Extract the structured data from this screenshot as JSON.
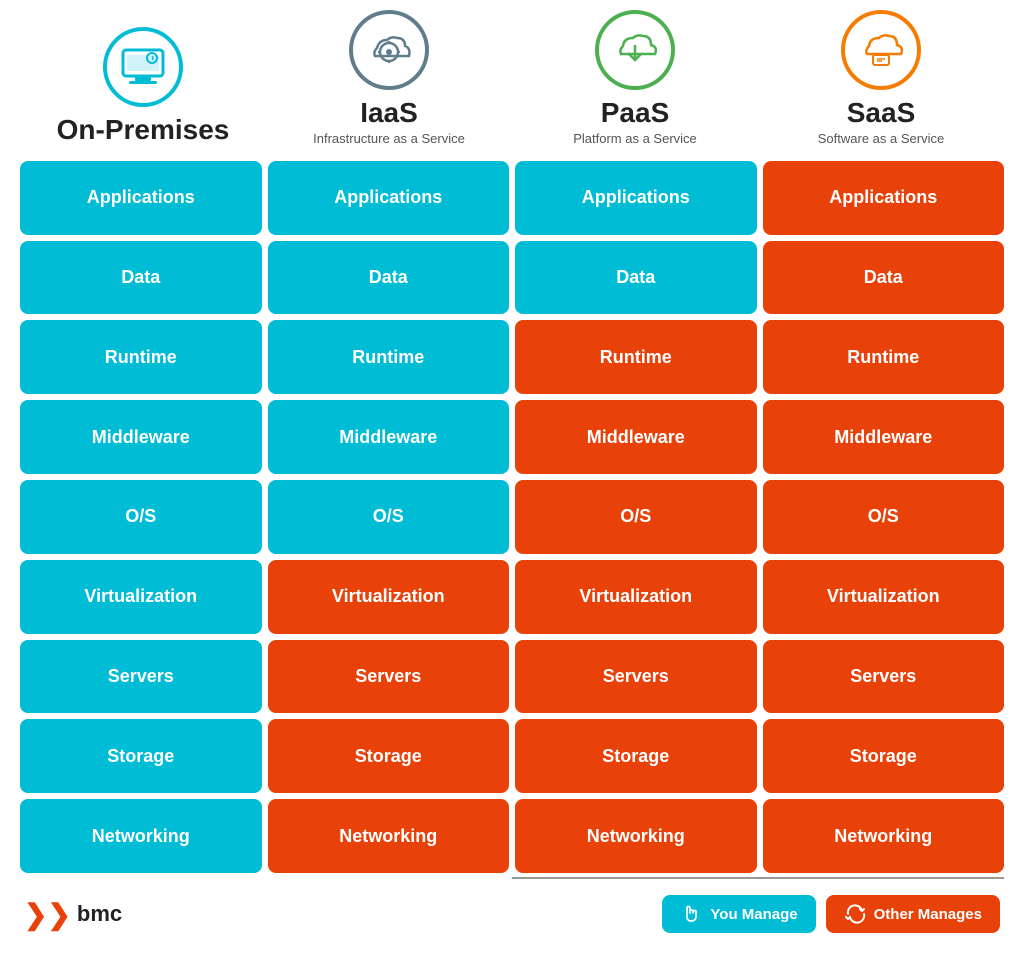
{
  "header": {
    "columns": [
      {
        "id": "on-premises",
        "title": "On-Premises",
        "subtitle": "",
        "icon_color": "blue",
        "icon_type": "monitor"
      },
      {
        "id": "iaas",
        "title": "IaaS",
        "subtitle": "Infrastructure as a Service",
        "icon_color": "gray",
        "icon_type": "gear-cloud"
      },
      {
        "id": "paas",
        "title": "PaaS",
        "subtitle": "Platform as a Service",
        "icon_color": "green",
        "icon_type": "cloud-download"
      },
      {
        "id": "saas",
        "title": "SaaS",
        "subtitle": "Software as a Service",
        "icon_color": "orange",
        "icon_type": "cloud-card"
      }
    ]
  },
  "rows": [
    {
      "label": "Applications",
      "colors": [
        "cyan",
        "cyan",
        "cyan",
        "orange"
      ]
    },
    {
      "label": "Data",
      "colors": [
        "cyan",
        "cyan",
        "cyan",
        "orange"
      ]
    },
    {
      "label": "Runtime",
      "colors": [
        "cyan",
        "cyan",
        "orange",
        "orange"
      ]
    },
    {
      "label": "Middleware",
      "colors": [
        "cyan",
        "cyan",
        "orange",
        "orange"
      ]
    },
    {
      "label": "O/S",
      "colors": [
        "cyan",
        "cyan",
        "orange",
        "orange"
      ]
    },
    {
      "label": "Virtualization",
      "colors": [
        "cyan",
        "orange",
        "orange",
        "orange"
      ]
    },
    {
      "label": "Servers",
      "colors": [
        "cyan",
        "orange",
        "orange",
        "orange"
      ]
    },
    {
      "label": "Storage",
      "colors": [
        "cyan",
        "orange",
        "orange",
        "orange"
      ]
    },
    {
      "label": "Networking",
      "colors": [
        "cyan",
        "orange",
        "orange",
        "orange"
      ]
    }
  ],
  "footer": {
    "brand": "bmc",
    "legend": [
      {
        "id": "you-manage",
        "label": "You Manage",
        "color": "cyan",
        "icon": "hand"
      },
      {
        "id": "other-manages",
        "label": "Other Manages",
        "color": "orange",
        "icon": "refresh"
      }
    ]
  }
}
